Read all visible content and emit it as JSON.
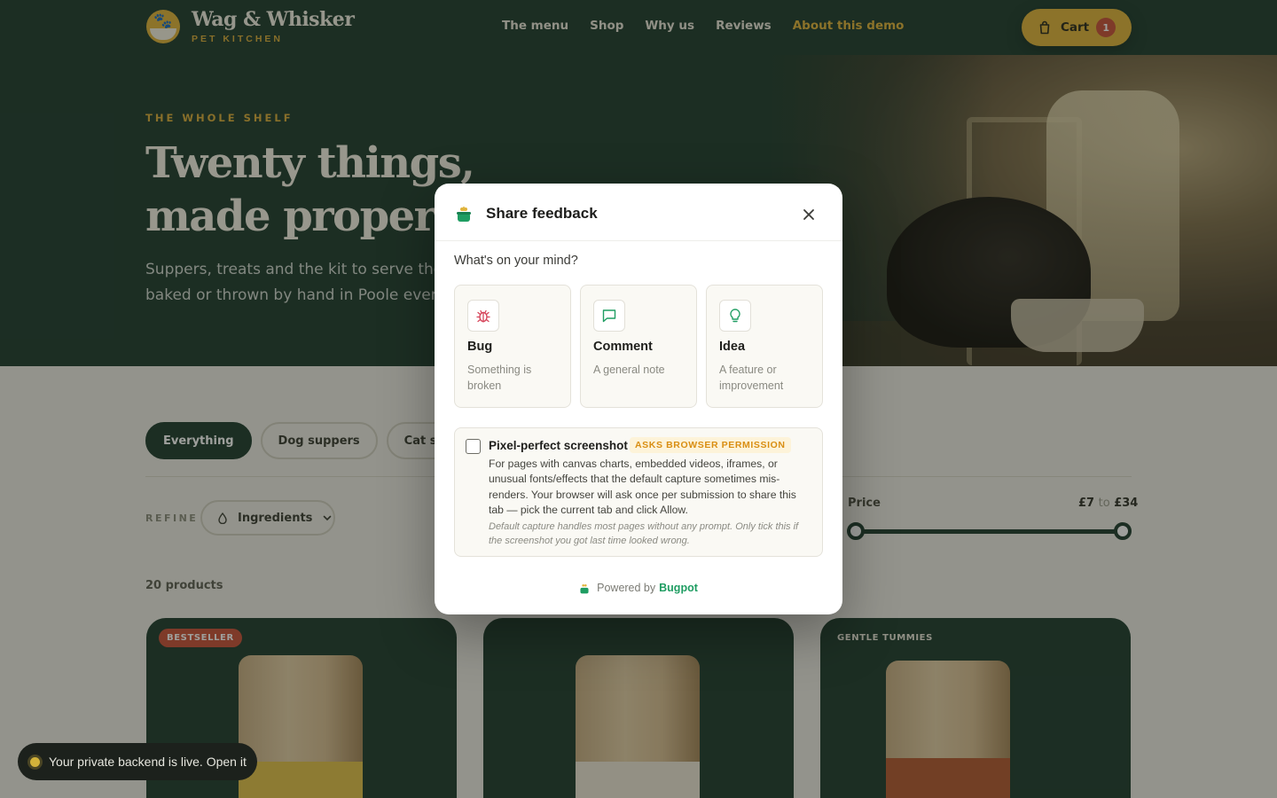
{
  "header": {
    "brand_name": "Wag & Whisker",
    "brand_sub": "PET KITCHEN",
    "nav": [
      "The menu",
      "Shop",
      "Why us",
      "Reviews",
      "About this demo"
    ],
    "cart_label": "Cart",
    "cart_count": "1"
  },
  "hero": {
    "eyebrow": "THE WHOLE SHELF",
    "title_line1": "Twenty things,",
    "title_line2": "made properl",
    "copy_line1": "Suppers, treats and the kit to serve them",
    "copy_line2": "baked or thrown by hand in Poole every"
  },
  "shop": {
    "chips": [
      "Everything",
      "Dog suppers",
      "Cat suppers"
    ],
    "refine_label": "REFINE",
    "ingredients_label": "Ingredients",
    "price_label": "Price",
    "price_min": "£7",
    "price_to": "to",
    "price_max": "£34",
    "product_count": "20 products",
    "cards": [
      {
        "tag": "BESTSELLER"
      },
      {
        "tag": ""
      },
      {
        "tag": "GENTLE TUMMIES"
      }
    ]
  },
  "toast": {
    "text": "Your private backend is live. Open it"
  },
  "modal": {
    "title": "Share feedback",
    "prompt": "What's on your mind?",
    "types": [
      {
        "icon": "bug-icon",
        "title": "Bug",
        "desc": "Something is broken"
      },
      {
        "icon": "comment-icon",
        "title": "Comment",
        "desc": "A general note"
      },
      {
        "icon": "lightbulb-icon",
        "title": "Idea",
        "desc": "A feature or improvement"
      }
    ],
    "screenshot": {
      "title": "Pixel-perfect screenshot",
      "badge": "ASKS BROWSER PERMISSION",
      "body": "For pages with canvas charts, embedded videos, iframes, or unusual fonts/effects that the default capture sometimes mis-renders. Your browser will ask once per submission to share this tab — pick the current tab and click Allow.",
      "note": "Default capture handles most pages without any prompt. Only tick this if the screenshot you got last time looked wrong.",
      "checked": false
    },
    "powered_by": "Powered by",
    "powered_brand": "Bugpot"
  },
  "colors": {
    "brand_green": "#1f3d2f",
    "accent_gold": "#e0b33b",
    "badge_red": "#c8513a",
    "bugpot_green": "#1f9d62",
    "permission_orange": "#d98e12"
  }
}
